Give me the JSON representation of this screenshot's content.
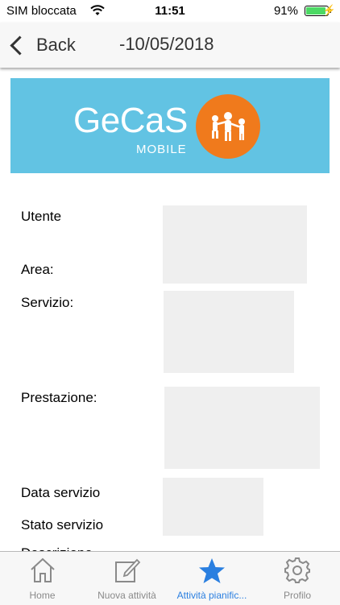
{
  "status": {
    "carrier": "SIM bloccata",
    "time": "11:51",
    "battery_percent": "91%",
    "battery_level": 0.91
  },
  "nav": {
    "back_label": "Back",
    "title": "-10/05/2018"
  },
  "banner": {
    "logo_text": "GeCaS",
    "logo_sub": "MOBILE",
    "colors": {
      "background": "#62c3e3",
      "circle": "#f07a1c"
    }
  },
  "form": {
    "utente_label": "Utente",
    "area_label": "Area:",
    "servizio_label": "Servizio:",
    "prestazione_label": "Prestazione:",
    "data_servizio_label": "Data servizio",
    "stato_servizio_label": "Stato servizio",
    "partial_label": "Descrizione"
  },
  "tabs": [
    {
      "label": "Home",
      "icon": "home-icon"
    },
    {
      "label": "Nuova attività",
      "icon": "compose-icon"
    },
    {
      "label": "Attività pianific...",
      "icon": "star-icon",
      "active": true
    },
    {
      "label": "Profilo",
      "icon": "gear-icon"
    }
  ],
  "colors": {
    "accent": "#2a7fe0",
    "tab_inactive": "#8a8a8a"
  }
}
